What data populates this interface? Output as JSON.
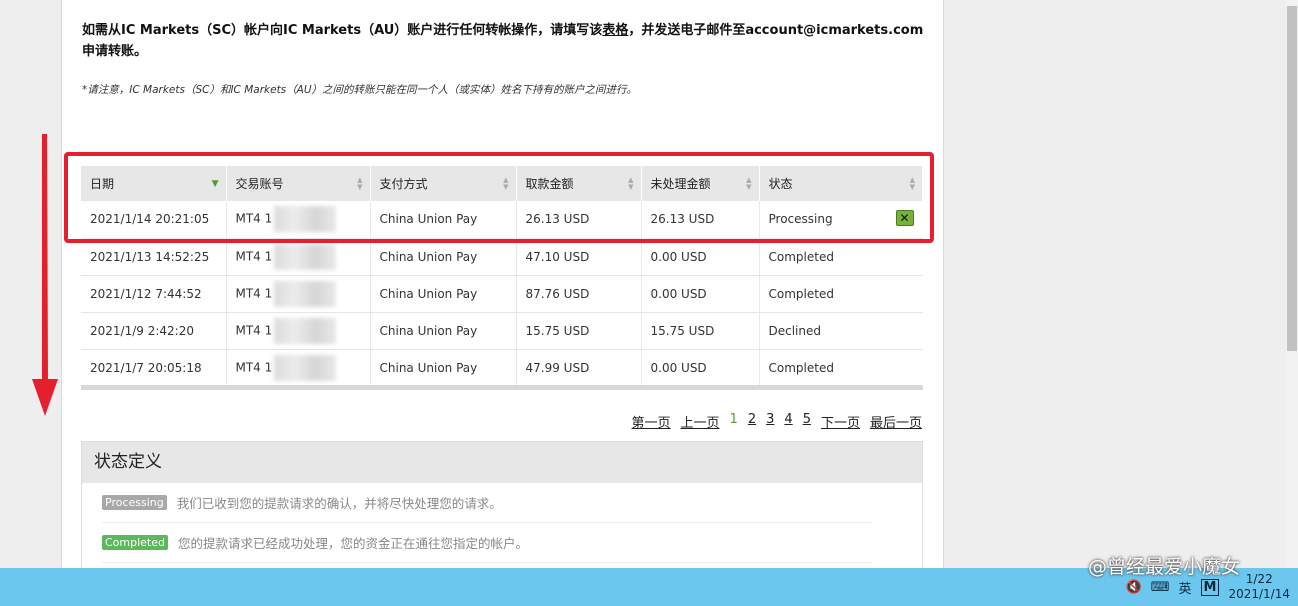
{
  "notice": {
    "pre": "如需从IC Markets（SC）帐户向IC Markets（AU）账户进行任何转帐操作，请填写该",
    "link": "表格",
    "post": "，并发送电子邮件至account@icmarkets.com 申请转账。"
  },
  "note": "*请注意，IC Markets（SC）和IC Markets（AU）之间的转账只能在同一个人（或实体）姓名下持有的账户之间进行。",
  "table": {
    "columns": [
      "日期",
      "交易账号",
      "支付方式",
      "取款金额",
      "未处理金额",
      "状态"
    ],
    "rows": [
      {
        "date": "2021/1/14 20:21:05",
        "account": "MT4 1",
        "method": "China Union Pay",
        "amount": "26.13 USD",
        "pending": "26.13 USD",
        "status": "Processing"
      },
      {
        "date": "2021/1/13 14:52:25",
        "account": "MT4 1",
        "method": "China Union Pay",
        "amount": "47.10 USD",
        "pending": "0.00 USD",
        "status": "Completed"
      },
      {
        "date": "2021/1/12 7:44:52",
        "account": "MT4 1",
        "method": "China Union Pay",
        "amount": "87.76 USD",
        "pending": "0.00 USD",
        "status": "Completed"
      },
      {
        "date": "2021/1/9 2:42:20",
        "account": "MT4 1",
        "method": "China Union Pay",
        "amount": "15.75 USD",
        "pending": "15.75 USD",
        "status": "Declined"
      },
      {
        "date": "2021/1/7 20:05:18",
        "account": "MT4 1",
        "method": "China Union Pay",
        "amount": "47.99 USD",
        "pending": "0.00 USD",
        "status": "Completed"
      }
    ],
    "cancel_glyph": "✕"
  },
  "pager": {
    "first": "第一页",
    "prev": "上一页",
    "pages": [
      "1",
      "2",
      "3",
      "4",
      "5"
    ],
    "next": "下一页",
    "last": "最后一页"
  },
  "status_def": {
    "title": "状态定义",
    "items": [
      {
        "badge": "Processing",
        "text": "我们已收到您的提款请求的确认，并将尽快处理您的请求。"
      },
      {
        "badge": "Completed",
        "text": "您的提款请求已经成功处理，您的资金正在通往您指定的帐户。"
      }
    ]
  },
  "taskbar": {
    "ime1": "英",
    "ime2": "M",
    "time": "1/22",
    "date": "2021/1/14"
  },
  "watermark": "@曾经最爱小魔女",
  "colors": {
    "highlight": "#e5202e",
    "accent_green": "#5a9b2e",
    "taskbar": "#6cc7ef"
  }
}
